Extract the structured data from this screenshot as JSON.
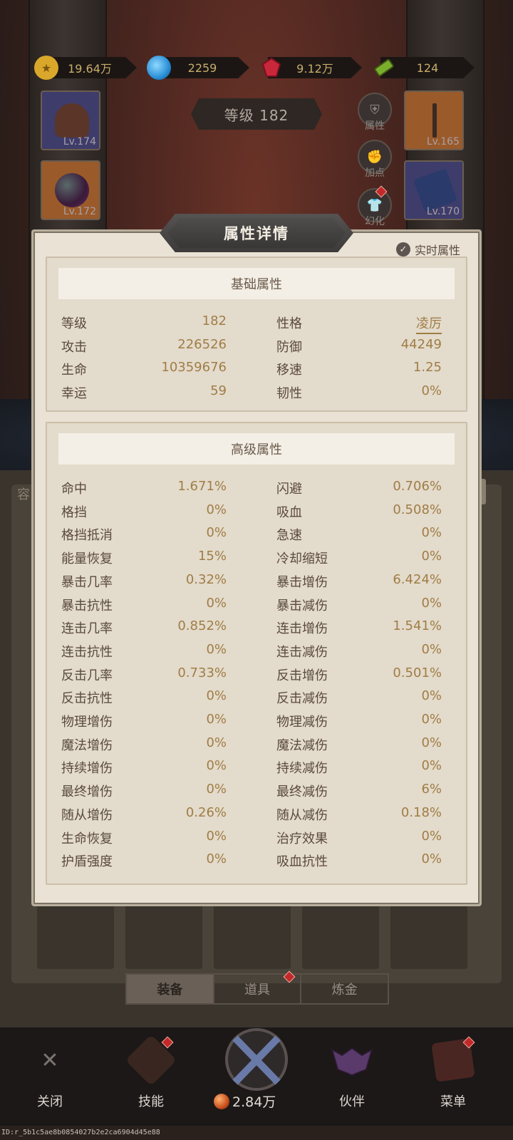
{
  "currencies": [
    {
      "icon": "gold-coin-icon",
      "value": "19.64万",
      "color": "#d9a72a"
    },
    {
      "icon": "blue-orb-icon",
      "value": "2259",
      "color": "#2a8fd6"
    },
    {
      "icon": "red-gem-icon",
      "value": "9.12万",
      "color": "#c8283a"
    },
    {
      "icon": "green-ticket-icon",
      "value": "124",
      "color": "#7cae2e"
    }
  ],
  "level_banner": "等级 182",
  "equipment": {
    "hat": "Lv.174",
    "orb": "Lv.172",
    "staff": "Lv.165",
    "book": "Lv.170"
  },
  "side_buttons": {
    "attributes": "属性",
    "add_points": "加点",
    "transform": "幻化"
  },
  "modal": {
    "title": "属性详情",
    "realtime_label": "实时属性",
    "basic": {
      "heading": "基础属性",
      "rows": [
        {
          "k1": "等级",
          "v1": "182",
          "k2": "性格",
          "v2": "凌厉"
        },
        {
          "k1": "攻击",
          "v1": "226526",
          "k2": "防御",
          "v2": "44249"
        },
        {
          "k1": "生命",
          "v1": "10359676",
          "k2": "移速",
          "v2": "1.25"
        },
        {
          "k1": "幸运",
          "v1": "59",
          "k2": "韧性",
          "v2": "0%"
        }
      ]
    },
    "advanced": {
      "heading": "高级属性",
      "rows": [
        {
          "k1": "命中",
          "v1": "1.671%",
          "k2": "闪避",
          "v2": "0.706%"
        },
        {
          "k1": "格挡",
          "v1": "0%",
          "k2": "吸血",
          "v2": "0.508%"
        },
        {
          "k1": "格挡抵消",
          "v1": "0%",
          "k2": "急速",
          "v2": "0%"
        },
        {
          "k1": "能量恢复",
          "v1": "15%",
          "k2": "冷却缩短",
          "v2": "0%"
        },
        {
          "k1": "暴击几率",
          "v1": "0.32%",
          "k2": "暴击增伤",
          "v2": "6.424%"
        },
        {
          "k1": "暴击抗性",
          "v1": "0%",
          "k2": "暴击减伤",
          "v2": "0%"
        },
        {
          "k1": "连击几率",
          "v1": "0.852%",
          "k2": "连击增伤",
          "v2": "1.541%"
        },
        {
          "k1": "连击抗性",
          "v1": "0%",
          "k2": "连击减伤",
          "v2": "0%"
        },
        {
          "k1": "反击几率",
          "v1": "0.733%",
          "k2": "反击增伤",
          "v2": "0.501%"
        },
        {
          "k1": "反击抗性",
          "v1": "0%",
          "k2": "反击减伤",
          "v2": "0%"
        },
        {
          "k1": "物理增伤",
          "v1": "0%",
          "k2": "物理减伤",
          "v2": "0%"
        },
        {
          "k1": "魔法增伤",
          "v1": "0%",
          "k2": "魔法减伤",
          "v2": "0%"
        },
        {
          "k1": "持续增伤",
          "v1": "0%",
          "k2": "持续减伤",
          "v2": "0%"
        },
        {
          "k1": "最终增伤",
          "v1": "0%",
          "k2": "最终减伤",
          "v2": "6%"
        },
        {
          "k1": "随从增伤",
          "v1": "0.26%",
          "k2": "随从减伤",
          "v2": "0.18%"
        },
        {
          "k1": "生命恢复",
          "v1": "0%",
          "k2": "治疗效果",
          "v2": "0%"
        },
        {
          "k1": "护盾强度",
          "v1": "0%",
          "k2": "吸血抗性",
          "v2": "0%"
        }
      ]
    }
  },
  "background_label": "容",
  "tabs": [
    "装备",
    "道具",
    "炼金"
  ],
  "nav": {
    "close": "关闭",
    "skills": "技能",
    "battle_power": "2.84万",
    "partner": "伙伴",
    "menu": "菜单"
  },
  "footer_id": "ID:r_5b1c5ae8b0854027b2e2ca6904d45e88"
}
